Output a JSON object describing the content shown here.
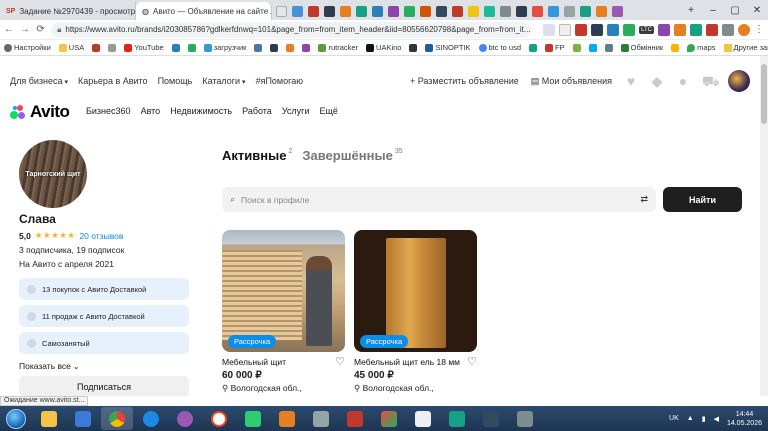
{
  "browser": {
    "tabs": [
      {
        "label": "Задание №2970439 - просмотр з",
        "icon": "sp-icon"
      },
      {
        "label": "Авито — Объявление на сайте Ав",
        "icon": "globe-icon"
      }
    ],
    "url": "https://www.avito.ru/brands/i203085786?gdlkerfdnwq=101&page_from=from_item_header&iid=80556620798&page_from=from_it...",
    "bookmarks": [
      "Настройки",
      "USA",
      "",
      "",
      "YouTube",
      "",
      "",
      "загрузчик",
      "",
      "",
      "",
      "",
      "rutracker",
      "UAKino",
      "",
      "SINOPTIK",
      "btc to usd",
      "",
      "FP",
      "",
      "",
      "",
      "Обмінник",
      "",
      "maps"
    ],
    "other_bookmarks": "Другие закладки",
    "ext_badge": "LTC"
  },
  "topnav": {
    "items": [
      "Для бизнеса",
      "Карьера в Авито",
      "Помощь",
      "Каталоги",
      "#яПомогаю"
    ],
    "post_ad": "+ Разместить объявление",
    "my_ads": "Мои объявления"
  },
  "logo": "Avito",
  "categories": [
    "Бизнес360",
    "Авто",
    "Недвижимость",
    "Работа",
    "Услуги",
    "Ещё"
  ],
  "profile": {
    "avatar_text": "Тарногский щит",
    "name": "Слава",
    "rating": "5,0",
    "stars": "★★★★★",
    "reviews": "20 отзывов",
    "followers": "3 подписчика, 19 подписок",
    "since": "На Авито с апреля 2021",
    "pills": [
      "13 покупок с Авито Доставкой",
      "11 продаж с Авито Доставкой",
      "Самозанятый"
    ],
    "show_all": "Показать все",
    "subscribe": "Подписаться"
  },
  "listing_tabs": {
    "active": "Активные",
    "active_count": "2",
    "completed": "Завершённые",
    "completed_count": "35"
  },
  "search": {
    "placeholder": "Поиск в профиле",
    "button": "Найти"
  },
  "cards": [
    {
      "badge": "Рассрочка",
      "title": "Мебельный щит",
      "price": "60 000 ₽",
      "location": "Вологодская обл.,"
    },
    {
      "badge": "Рассрочка",
      "title": "Мебельный щит ель 18 мм",
      "price": "45 000 ₽",
      "location": "Вологодская обл.,"
    }
  ],
  "status_bar": "Ожидание www.avito.st...",
  "taskbar": {
    "lang": "UK",
    "time": "14:44",
    "date": "14.05.2026"
  },
  "colors": {
    "accent": "#0a8ee8",
    "star": "#ffb021",
    "dark_button": "#1f1f1f"
  }
}
